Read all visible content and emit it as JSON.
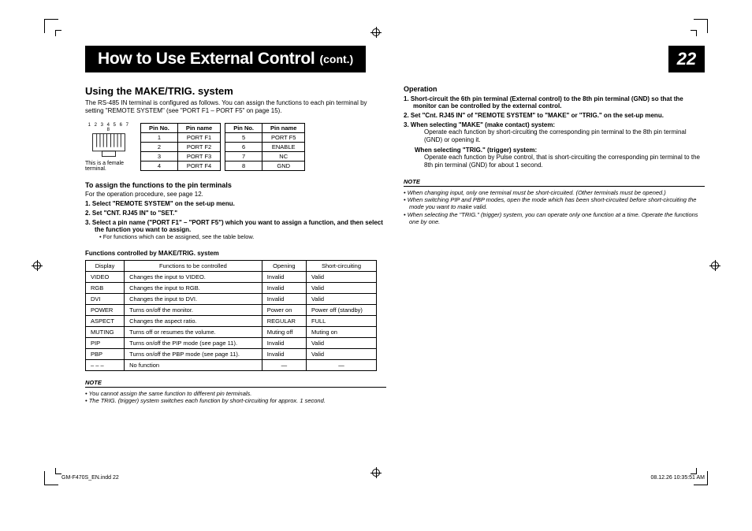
{
  "header": {
    "title_main": "How to Use External Control",
    "title_cont": "(cont.)",
    "page_number": "22"
  },
  "left": {
    "heading": "Using the MAKE/TRIG. system",
    "intro": "The RS-485 IN terminal is configured as follows. You can assign the functions to each pin terminal by setting \"REMOTE SYSTEM\" (see \"PORT F1 – PORT F5\" on page 15).",
    "rj45_caption": "This is a female terminal.",
    "pin_labels": "1 2 3 4  5 6 7 8",
    "pin_table": {
      "columns_a": [
        "Pin No.",
        "Pin name"
      ],
      "columns_b": [
        "Pin No.",
        "Pin name"
      ],
      "rows_a": [
        [
          "1",
          "PORT F1"
        ],
        [
          "2",
          "PORT F2"
        ],
        [
          "3",
          "PORT F3"
        ],
        [
          "4",
          "PORT F4"
        ]
      ],
      "rows_b": [
        [
          "5",
          "PORT F5"
        ],
        [
          "6",
          "ENABLE"
        ],
        [
          "7",
          "NC"
        ],
        [
          "8",
          "GND"
        ]
      ]
    },
    "assign_heading": "To assign the functions to the pin terminals",
    "assign_intro": "For the operation procedure, see page 12.",
    "steps": [
      "Select \"REMOTE SYSTEM\" on the set-up menu.",
      "Set \"CNT. RJ45 IN\" to \"SET.\"",
      "Select a pin name (\"PORT F1\" – \"PORT F5\") which you want to assign a function, and then select the function you want to assign."
    ],
    "step3_sub": "For functions which can be assigned, see the table below.",
    "func_title": "Functions controlled by MAKE/TRIG. system",
    "func_columns": [
      "Display",
      "Functions to be controlled",
      "Opening",
      "Short-circuiting"
    ],
    "func_rows": [
      [
        "VIDEO",
        "Changes the input to VIDEO.",
        "Invalid",
        "Valid"
      ],
      [
        "RGB",
        "Changes the input to RGB.",
        "Invalid",
        "Valid"
      ],
      [
        "DVI",
        "Changes the input to DVI.",
        "Invalid",
        "Valid"
      ],
      [
        "POWER",
        "Turns on/off the monitor.",
        "Power on",
        "Power off (standby)"
      ],
      [
        "ASPECT",
        "Changes the aspect ratio.",
        "REGULAR",
        "FULL"
      ],
      [
        "MUTING",
        "Turns off or resumes the volume.",
        "Muting off",
        "Muting on"
      ],
      [
        "PIP",
        "Turns on/off the PIP mode (see page 11).",
        "Invalid",
        "Valid"
      ],
      [
        "PBP",
        "Turns on/off the PBP mode (see page 11).",
        "Invalid",
        "Valid"
      ],
      [
        "– – –",
        "No function",
        "—",
        "—"
      ]
    ],
    "note_label": "NOTE",
    "notes": [
      "You cannot assign the same function to different pin terminals.",
      "The TRIG. (trigger) system switches each function by short-circuiting for approx. 1 second."
    ]
  },
  "right": {
    "op_heading": "Operation",
    "steps": [
      "Short-circuit the 6th pin terminal (External control) to the 8th pin terminal (GND) so that the monitor can be controlled by the external control.",
      "Set \"Cnt. RJ45 IN\" of \"REMOTE SYSTEM\" to \"MAKE\" or \"TRIG.\" on the set-up menu.",
      "When selecting \"MAKE\" (make contact) system:"
    ],
    "step3_sub": "Operate each function by short-circuiting the corresponding pin terminal to the 8th pin terminal (GND) or opening it.",
    "trig_bold": "When selecting \"TRIG.\" (trigger) system:",
    "trig_sub": "Operate each function by Pulse control, that is short-circuiting the corresponding pin terminal to the 8th pin terminal (GND) for about 1 second.",
    "note_label": "NOTE",
    "notes": [
      "When changing input, only one terminal must be short-circuited. (Other terminals must be opened.)",
      "When switching PIP and PBP modes, open the mode which has been short-circuited before short-circuiting the mode you want to make valid.",
      "When selecting the \"TRIG.\" (trigger) system, you can operate only one function at a time. Operate the functions one by one."
    ]
  },
  "footer": {
    "left": "GM-F470S_EN.indd   22",
    "right": "08.12.26   10:35:51 AM"
  }
}
